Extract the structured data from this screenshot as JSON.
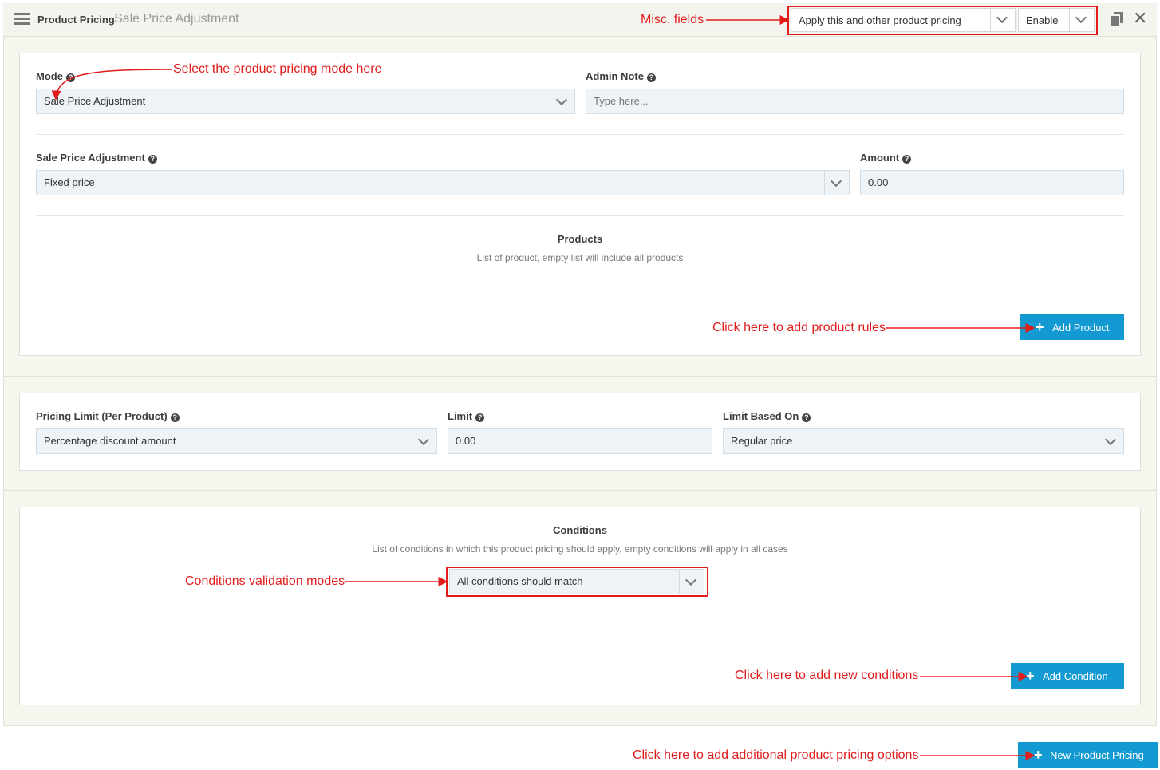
{
  "header": {
    "title": "Product Pricing",
    "subtitle": "Sale Price Adjustment",
    "apply_select": "Apply this and other product pricing",
    "status_select": "Enable"
  },
  "mode_panel": {
    "mode_label": "Mode",
    "mode_value": "Sale Price Adjustment",
    "admin_note_label": "Admin Note",
    "admin_note_placeholder": "Type here...",
    "adjustment_label": "Sale Price Adjustment",
    "adjustment_value": "Fixed price",
    "amount_label": "Amount",
    "amount_value": "0.00",
    "products_title": "Products",
    "products_subtitle": "List of product, empty list will include all products",
    "add_product_label": "Add Product"
  },
  "limit_panel": {
    "pricing_limit_label": "Pricing Limit (Per Product)",
    "pricing_limit_value": "Percentage discount amount",
    "limit_label": "Limit",
    "limit_value": "0.00",
    "limit_based_label": "Limit Based On",
    "limit_based_value": "Regular price"
  },
  "conditions_panel": {
    "title": "Conditions",
    "subtitle": "List of conditions in which this product pricing should apply, empty conditions will apply in all cases",
    "match_value": "All conditions should match",
    "add_condition_label": "Add Condition"
  },
  "footer": {
    "new_pricing_label": "New Product Pricing"
  },
  "annotations": {
    "misc": "Misc. fields",
    "mode": "Select the product pricing mode here",
    "product_rules": "Click here to add product rules",
    "conditions_modes": "Conditions validation modes",
    "new_conditions": "Click here to add new conditions",
    "additional": "Click here to add additional product pricing options"
  },
  "colors": {
    "accent": "#139ad3",
    "annotation": "#e21b1b",
    "field_bg": "#eef3f7"
  }
}
